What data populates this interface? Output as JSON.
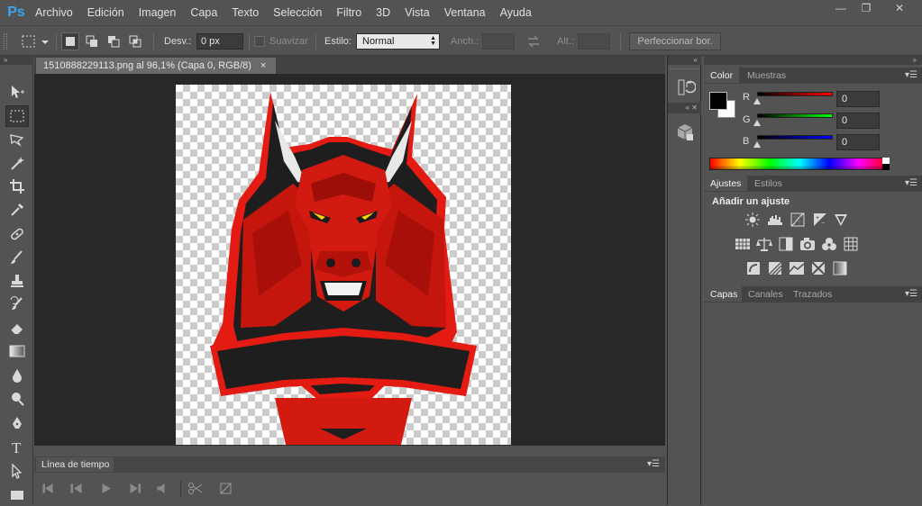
{
  "app": {
    "logo": "Ps"
  },
  "menu": [
    "Archivo",
    "Edición",
    "Imagen",
    "Capa",
    "Texto",
    "Selección",
    "Filtro",
    "3D",
    "Vista",
    "Ventana",
    "Ayuda"
  ],
  "window_controls": {
    "minimize": "—",
    "restore": "❐",
    "close": "✕"
  },
  "options": {
    "feather_label": "Desv.:",
    "feather_value": "0 px",
    "smooth_label": "Suavizar",
    "style_label": "Estilo:",
    "style_value": "Normal",
    "width_label": "Anch.:",
    "height_label": "Alt.:",
    "refine_button": "Perfeccionar bor."
  },
  "document": {
    "tab_title": "1510888229113.png al 96,1% (Capa 0, RGB/8)",
    "close_glyph": "×"
  },
  "timeline": {
    "tab_label": "Línea de tiempo"
  },
  "panels": {
    "color": {
      "tabs": [
        "Color",
        "Muestras"
      ],
      "channels": [
        {
          "label": "R",
          "value": "0"
        },
        {
          "label": "G",
          "value": "0"
        },
        {
          "label": "B",
          "value": "0"
        }
      ],
      "foreground": "#000000",
      "background": "#ffffff"
    },
    "adjustments": {
      "tabs": [
        "Ajustes",
        "Estilos"
      ],
      "heading": "Añadir un ajuste"
    },
    "layers": {
      "tabs": [
        "Capas",
        "Canales",
        "Trazados"
      ]
    }
  },
  "colors": {
    "ui_bg": "#535353",
    "doc_bg": "#282828",
    "accent_blue": "#3ba5f0",
    "bull_red": "#c5160e",
    "bull_dark": "#1e1e1e"
  }
}
